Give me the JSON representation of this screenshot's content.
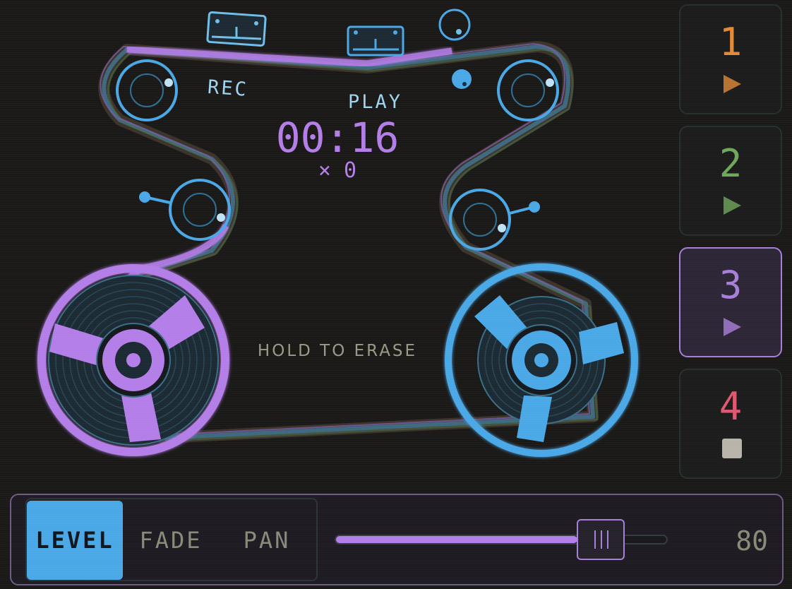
{
  "deck": {
    "rec_label": "REC",
    "play_label": "PLAY",
    "time": "00:16",
    "multiplier": "× 0",
    "erase_hint": "HOLD TO ERASE"
  },
  "tracks": [
    {
      "number": "1",
      "state": "play",
      "color": "#e08a3a",
      "selected": false
    },
    {
      "number": "2",
      "state": "play",
      "color": "#6fa85a",
      "selected": false
    },
    {
      "number": "3",
      "state": "play",
      "color": "#a77fd9",
      "selected": true
    },
    {
      "number": "4",
      "state": "stop",
      "color": "#e05870",
      "selected": false
    }
  ],
  "controls": {
    "tabs": [
      "LEVEL",
      "FADE",
      "PAN"
    ],
    "active_tab": "LEVEL",
    "slider_value": "80",
    "slider_fraction": 0.8
  },
  "colors": {
    "accent_purple": "#b47ee8",
    "accent_blue": "#4ba8e6",
    "muted_text": "#8a8a78"
  }
}
